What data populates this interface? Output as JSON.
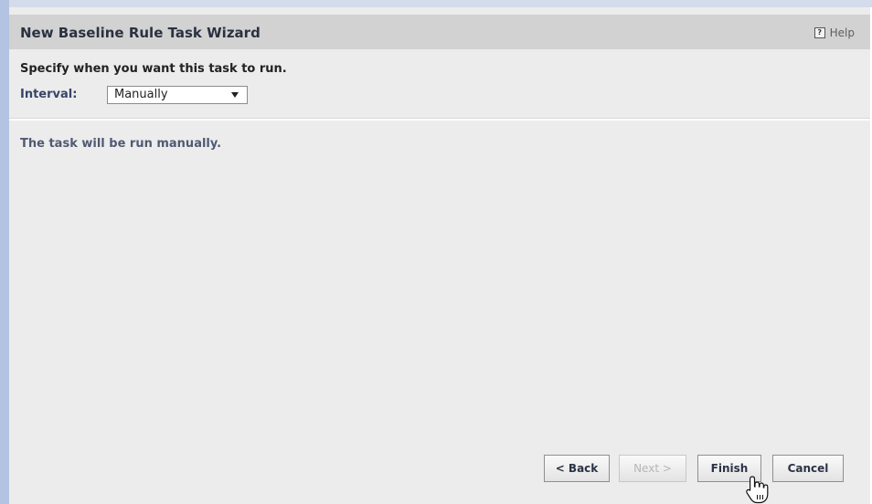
{
  "dialog": {
    "title": "New Baseline Rule Task Wizard",
    "help_label": "Help",
    "help_icon": "help-icon"
  },
  "form": {
    "heading": "Specify when you want this task to run.",
    "interval_label": "Interval:",
    "interval_value": "Manually"
  },
  "message": "The task will be run manually.",
  "buttons": {
    "back": "< Back",
    "next": "Next >",
    "finish": "Finish",
    "cancel": "Cancel"
  },
  "colors": {
    "title_bar": "#d2d2d2",
    "dialog_bg": "#ececec",
    "left_accent": "#b3c3e2"
  }
}
